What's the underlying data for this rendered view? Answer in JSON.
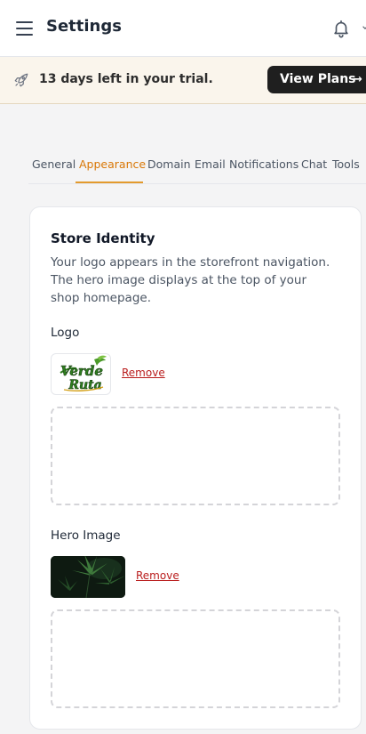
{
  "header": {
    "title": "Settings",
    "menu_icon": "hamburger-menu-icon",
    "notification_icon": "bell-icon"
  },
  "trial": {
    "icon": "rocket-icon",
    "text": "13 days left in your trial.",
    "button_label": "View Plans",
    "button_arrow": "→"
  },
  "tabs": [
    {
      "label": "General",
      "active": false
    },
    {
      "label": "Appearance",
      "active": true
    },
    {
      "label": "Domain",
      "active": false
    },
    {
      "label": "Email",
      "active": false
    },
    {
      "label": "Notifications",
      "active": false
    },
    {
      "label": "Chat",
      "active": false
    },
    {
      "label": "Tools",
      "active": false
    }
  ],
  "store_identity": {
    "title": "Store Identity",
    "description": "Your logo appears in the storefront navigation. The hero image displays at the top of your shop homepage.",
    "logo": {
      "label": "Logo",
      "remove_label": "Remove",
      "logo_text_line1": "Verde",
      "logo_text_line2": "Ruta"
    },
    "hero": {
      "label": "Hero Image",
      "remove_label": "Remove"
    }
  },
  "colors": {
    "accent": "#d97706",
    "remove": "#b91c1c",
    "button_dark": "#1f1f1f",
    "trial_bg": "#faf5ec",
    "logo_green": "#2f7d1f"
  }
}
